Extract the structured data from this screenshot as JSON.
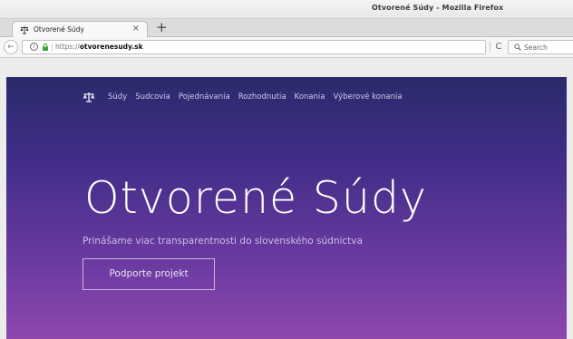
{
  "window": {
    "title": "Otvorené Súdy - Mozilla Firefox"
  },
  "tabs": [
    {
      "label": "Otvorené Súdy",
      "icon": "scales-icon"
    }
  ],
  "tab_close_symbol": "×",
  "new_tab_symbol": "+",
  "navbar": {
    "back_symbol": "←",
    "info_symbol": "i",
    "url_prefix": "https://",
    "url_host": "otvorenesudy.sk",
    "reload_symbol": "C",
    "search_placeholder": "Search"
  },
  "site": {
    "nav_items": [
      "Súdy",
      "Sudcovia",
      "Pojednávania",
      "Rozhodnutia",
      "Konania",
      "Výberové konania"
    ],
    "hero_title": "Otvorené Súdy",
    "hero_subtitle": "Prinášame viac transparentnosti do slovenského súdnictva",
    "cta_label": "Podporte projekt"
  },
  "colors": {
    "page_gradient_top": "#2a2b6b",
    "page_gradient_bottom": "#8d47ad",
    "hero_text": "#ffffff"
  }
}
